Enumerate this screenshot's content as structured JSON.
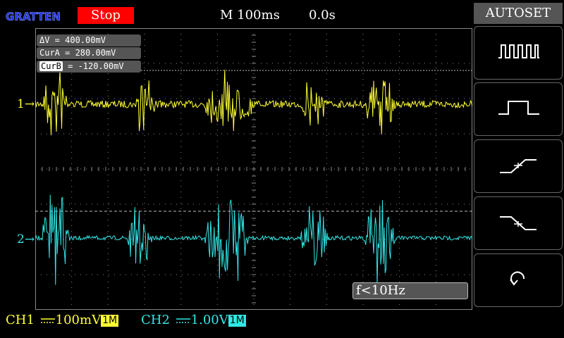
{
  "top_bar": {
    "logo_text": "GRATTEN",
    "run_state": "Stop",
    "timebase": "M 100ms",
    "trigger_offset": "0.0s"
  },
  "cursors": {
    "delta_label": "ΔV",
    "delta_value": " = 400.00mV",
    "cur_a_label": "CurA",
    "cur_a_value": " = 280.00mV",
    "cur_b_label": "CurB",
    "cur_b_value": " = -120.00mV"
  },
  "channels": {
    "ch1": {
      "marker": "1→",
      "name": "CH1",
      "scale": "100mV",
      "impedance": "1M",
      "color": "#ffff33"
    },
    "ch2": {
      "marker": "2→",
      "name": "CH2",
      "scale": "1.00V",
      "impedance": "1M",
      "color": "#33e6e6"
    }
  },
  "frequency": "f<10Hz",
  "menu": {
    "title": "AUTOSET",
    "buttons": [
      {
        "icon": "multi-pulse-icon"
      },
      {
        "icon": "single-pulse-icon"
      },
      {
        "icon": "rising-edge-icon"
      },
      {
        "icon": "falling-edge-icon"
      },
      {
        "icon": "undo-icon"
      }
    ]
  },
  "colors": {
    "grid": "#888888",
    "run_state_bg": "#ff0000",
    "panel": "#555555"
  }
}
